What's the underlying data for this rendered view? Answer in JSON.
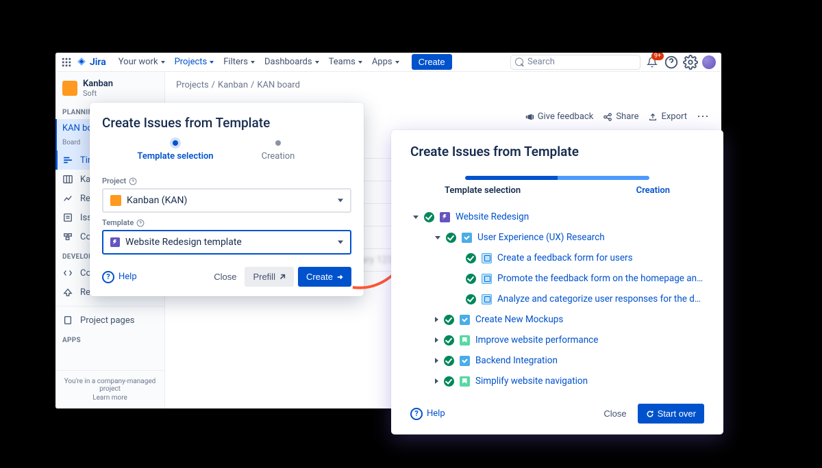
{
  "brand": "Jira",
  "nav": {
    "items": [
      {
        "label": "Your work"
      },
      {
        "label": "Projects"
      },
      {
        "label": "Filters"
      },
      {
        "label": "Dashboards"
      },
      {
        "label": "Teams"
      },
      {
        "label": "Apps"
      }
    ],
    "create": "Create",
    "search_placeholder": "Search",
    "notif_count": "9+"
  },
  "sidebar": {
    "project_name": "Kanban",
    "project_type": "Soft",
    "sections": {
      "planning": "PLANNING",
      "development": "DEVELOPMENT",
      "apps": "APPS"
    },
    "board": {
      "name": "KAN boa",
      "sub": "Board"
    },
    "items": [
      {
        "label": "Tim"
      },
      {
        "label": "Ka"
      },
      {
        "label": "Rep"
      },
      {
        "label": "Issu"
      },
      {
        "label": "Con"
      }
    ],
    "dev": [
      {
        "label": "Code"
      },
      {
        "label": "Releases"
      }
    ],
    "project_pages": "Project pages",
    "footer_line1": "You're in a company-managed project",
    "footer_line2": "Learn more"
  },
  "breadcrumb": [
    "Projects",
    "Kanban",
    "KAN board"
  ],
  "actions": {
    "feedback": "Give feedback",
    "share": "Share",
    "export": "Export"
  },
  "dialog1": {
    "title": "Create Issues from Template",
    "step1": "Template selection",
    "step2": "Creation",
    "project_label": "Project",
    "project_value": "Kanban (KAN)",
    "template_label": "Template",
    "template_value": "Website Redesign template",
    "help": "Help",
    "close": "Close",
    "prefill": "Prefill",
    "create": "Create"
  },
  "dialog2": {
    "title": "Create Issues from Template",
    "step1": "Template selection",
    "step2": "Creation",
    "tree": [
      {
        "level": 1,
        "open": true,
        "type": "epic",
        "label": "Website Redesign"
      },
      {
        "level": 2,
        "open": true,
        "type": "task",
        "label": "User Experience (UX) Research"
      },
      {
        "level": 3,
        "open": false,
        "nocaret": true,
        "type": "subtask",
        "label": "Create a feedback form for users"
      },
      {
        "level": 3,
        "open": false,
        "nocaret": true,
        "type": "subtask",
        "label": "Promote the feedback form on the homepage and social media ch"
      },
      {
        "level": 3,
        "open": false,
        "nocaret": true,
        "type": "subtask",
        "label": "Analyze and categorize user responses for the design team"
      },
      {
        "level": 2,
        "open": false,
        "type": "task",
        "label": "Create New Mockups"
      },
      {
        "level": 2,
        "open": false,
        "type": "story",
        "label": "Improve website performance"
      },
      {
        "level": 2,
        "open": false,
        "type": "task",
        "label": "Backend Integration"
      },
      {
        "level": 2,
        "open": false,
        "type": "story",
        "label": "Simplify website navigation"
      }
    ],
    "help": "Help",
    "close": "Close",
    "startover": "Start over"
  }
}
